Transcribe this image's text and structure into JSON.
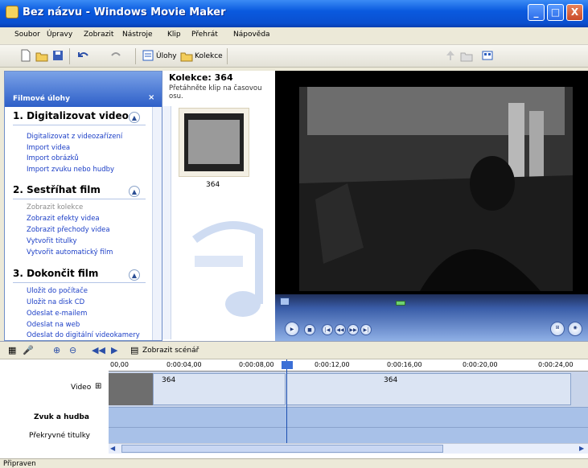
{
  "window": {
    "title": "Bez názvu - Windows Movie Maker",
    "min": "_",
    "max": "□",
    "close": "X"
  },
  "menu": [
    "Soubor",
    "Úpravy",
    "Zobrazit",
    "Nástroje",
    "Klip",
    "Přehrát",
    "Nápověda"
  ],
  "toolbar": {
    "tasks_label": "Úlohy",
    "collections_label": "Kolekce",
    "collection_value": "364"
  },
  "tasks": {
    "title": "Filmové úlohy",
    "close": "×",
    "sections": [
      {
        "heading": "1. Digitalizovat video",
        "links": [
          "Digitalizovat z videozařízení",
          "Import videa",
          "Import obrázků",
          "Import zvuku nebo hudby"
        ]
      },
      {
        "heading": "2. Sestříhat film",
        "links": [
          "Zobrazit kolekce",
          "Zobrazit efekty videa",
          "Zobrazit přechody videa",
          "Vytvořit titulky",
          "Vytvořit automatický film"
        ]
      },
      {
        "heading": "3. Dokončit film",
        "links": [
          "Uložit do počítače",
          "Uložit na disk CD",
          "Odeslat e-mailem",
          "Odeslat na web",
          "Odeslat do digitální videokamery"
        ]
      }
    ]
  },
  "collection": {
    "title": "Kolekce: 364",
    "hint": "Přetáhněte klip na časovou osu.",
    "clip_label": "364"
  },
  "timeline": {
    "storyboard_label": "Zobrazit scénář",
    "ticks": [
      "00,00",
      "0:00:04,00",
      "0:00:08,00",
      "0:00:12,00",
      "0:00:16,00",
      "0:00:20,00",
      "0:00:24,00"
    ],
    "tracks": {
      "video": "Video",
      "audio": "Zvuk a hudba",
      "overlay": "Překryvné titulky"
    },
    "clips": [
      "364",
      "364"
    ]
  },
  "status": "Připraven"
}
